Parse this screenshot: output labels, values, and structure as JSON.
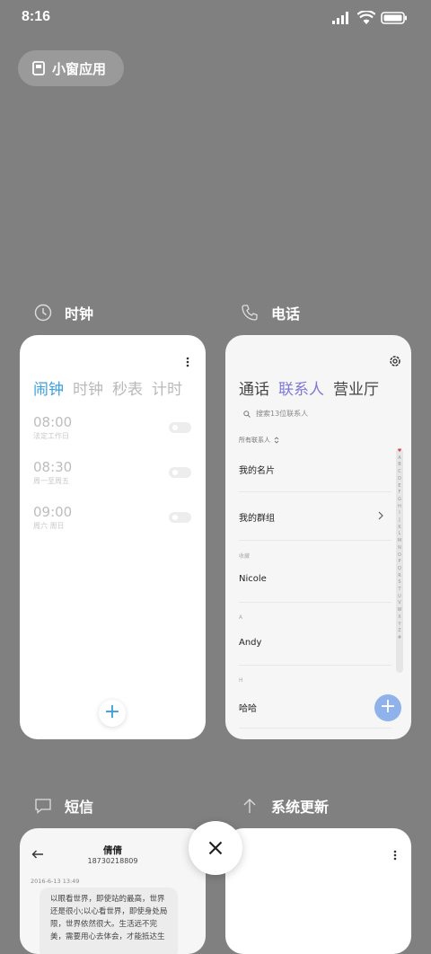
{
  "status_bar": {
    "time": "8:16"
  },
  "small_window": {
    "label": "小窗应用"
  },
  "apps": {
    "clock": {
      "name": "时钟",
      "tabs": [
        "闹钟",
        "时钟",
        "秒表",
        "计时"
      ],
      "alarms": [
        {
          "time": "08:00",
          "repeat": "法定工作日"
        },
        {
          "time": "08:30",
          "repeat": "周一至周五"
        },
        {
          "time": "09:00",
          "repeat": "周六 周日"
        }
      ],
      "add_symbol": "+"
    },
    "phone": {
      "name": "电话",
      "tabs": [
        "通话",
        "联系人",
        "营业厅"
      ],
      "search_placeholder": "搜索13位联系人",
      "filter": "所有联系人",
      "my_card": "我的名片",
      "my_groups": "我的群组",
      "sections": [
        {
          "header": "收藏",
          "contact": "Nicole"
        },
        {
          "header": "A",
          "contact": "Andy"
        },
        {
          "header": "H",
          "contact": "哈哈"
        }
      ],
      "alphabet": [
        "♥",
        "A",
        "B",
        "C",
        "D",
        "E",
        "F",
        "G",
        "H",
        "I",
        "J",
        "K",
        "L",
        "M",
        "N",
        "O",
        "P",
        "Q",
        "R",
        "S",
        "T",
        "U",
        "V",
        "W",
        "X",
        "Y",
        "Z",
        "#"
      ],
      "add_symbol": "+"
    },
    "sms": {
      "name": "短信",
      "contact_name": "倩倩",
      "contact_number": "18730218809",
      "timestamp": "2016-6-13 13:49",
      "message": "以眼看世界，即使站的最高，世界还是很小;以心看世界，即使身处局限，世界依然很大。生活远不完美，需要用心去体会，才能抵达生"
    },
    "update": {
      "name": "系统更新"
    }
  },
  "colors": {
    "background": "#808080",
    "clock_accent": "#3a9ee0",
    "phone_accent": "#7e79d6",
    "phone_fab": "#8fb2ec"
  }
}
